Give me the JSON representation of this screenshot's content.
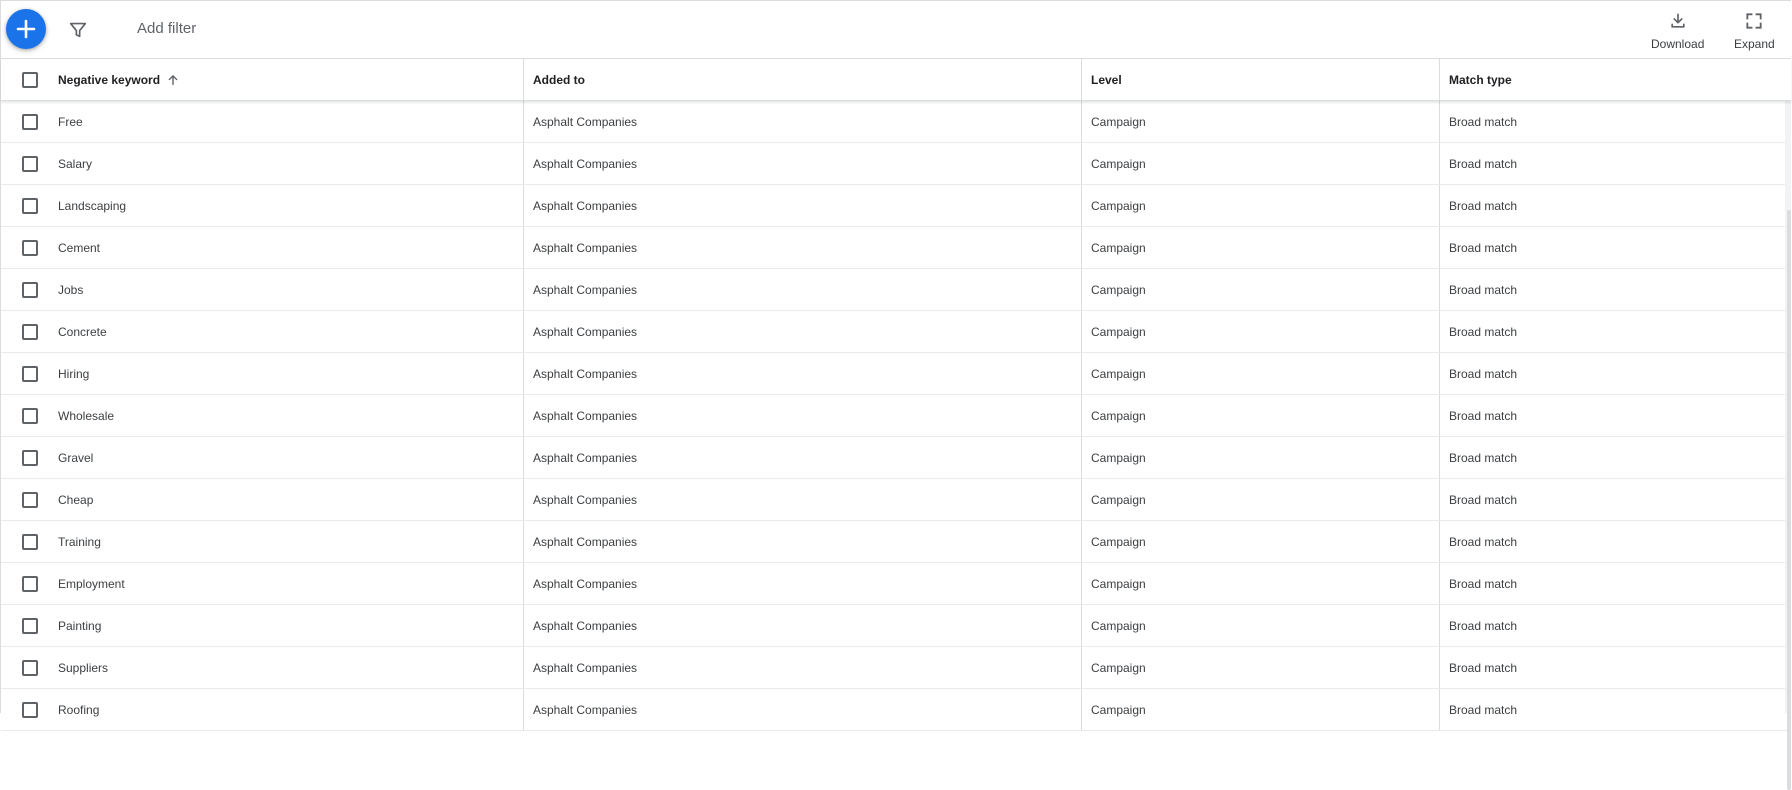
{
  "toolbar": {
    "add_filter_label": "Add filter",
    "download_label": "Download",
    "expand_label": "Expand",
    "accent_color": "#1a73e8"
  },
  "table": {
    "headers": {
      "keyword": "Negative keyword",
      "added_to": "Added to",
      "level": "Level",
      "match_type": "Match type"
    },
    "sort": {
      "column": "Negative keyword",
      "direction": "ascending"
    },
    "rows": [
      {
        "keyword": "Free",
        "added_to": "Asphalt Companies",
        "level": "Campaign",
        "match_type": "Broad match"
      },
      {
        "keyword": "Salary",
        "added_to": "Asphalt Companies",
        "level": "Campaign",
        "match_type": "Broad match"
      },
      {
        "keyword": "Landscaping",
        "added_to": "Asphalt Companies",
        "level": "Campaign",
        "match_type": "Broad match"
      },
      {
        "keyword": "Cement",
        "added_to": "Asphalt Companies",
        "level": "Campaign",
        "match_type": "Broad match"
      },
      {
        "keyword": "Jobs",
        "added_to": "Asphalt Companies",
        "level": "Campaign",
        "match_type": "Broad match"
      },
      {
        "keyword": "Concrete",
        "added_to": "Asphalt Companies",
        "level": "Campaign",
        "match_type": "Broad match"
      },
      {
        "keyword": "Hiring",
        "added_to": "Asphalt Companies",
        "level": "Campaign",
        "match_type": "Broad match"
      },
      {
        "keyword": "Wholesale",
        "added_to": "Asphalt Companies",
        "level": "Campaign",
        "match_type": "Broad match"
      },
      {
        "keyword": "Gravel",
        "added_to": "Asphalt Companies",
        "level": "Campaign",
        "match_type": "Broad match"
      },
      {
        "keyword": "Cheap",
        "added_to": "Asphalt Companies",
        "level": "Campaign",
        "match_type": "Broad match"
      },
      {
        "keyword": "Training",
        "added_to": "Asphalt Companies",
        "level": "Campaign",
        "match_type": "Broad match"
      },
      {
        "keyword": "Employment",
        "added_to": "Asphalt Companies",
        "level": "Campaign",
        "match_type": "Broad match"
      },
      {
        "keyword": "Painting",
        "added_to": "Asphalt Companies",
        "level": "Campaign",
        "match_type": "Broad match"
      },
      {
        "keyword": "Suppliers",
        "added_to": "Asphalt Companies",
        "level": "Campaign",
        "match_type": "Broad match"
      },
      {
        "keyword": "Roofing",
        "added_to": "Asphalt Companies",
        "level": "Campaign",
        "match_type": "Broad match"
      }
    ]
  },
  "icons": {
    "add": "plus-icon",
    "filter": "filter-icon",
    "download": "download-icon",
    "expand": "fullscreen-icon",
    "sort": "arrow-up-icon"
  }
}
